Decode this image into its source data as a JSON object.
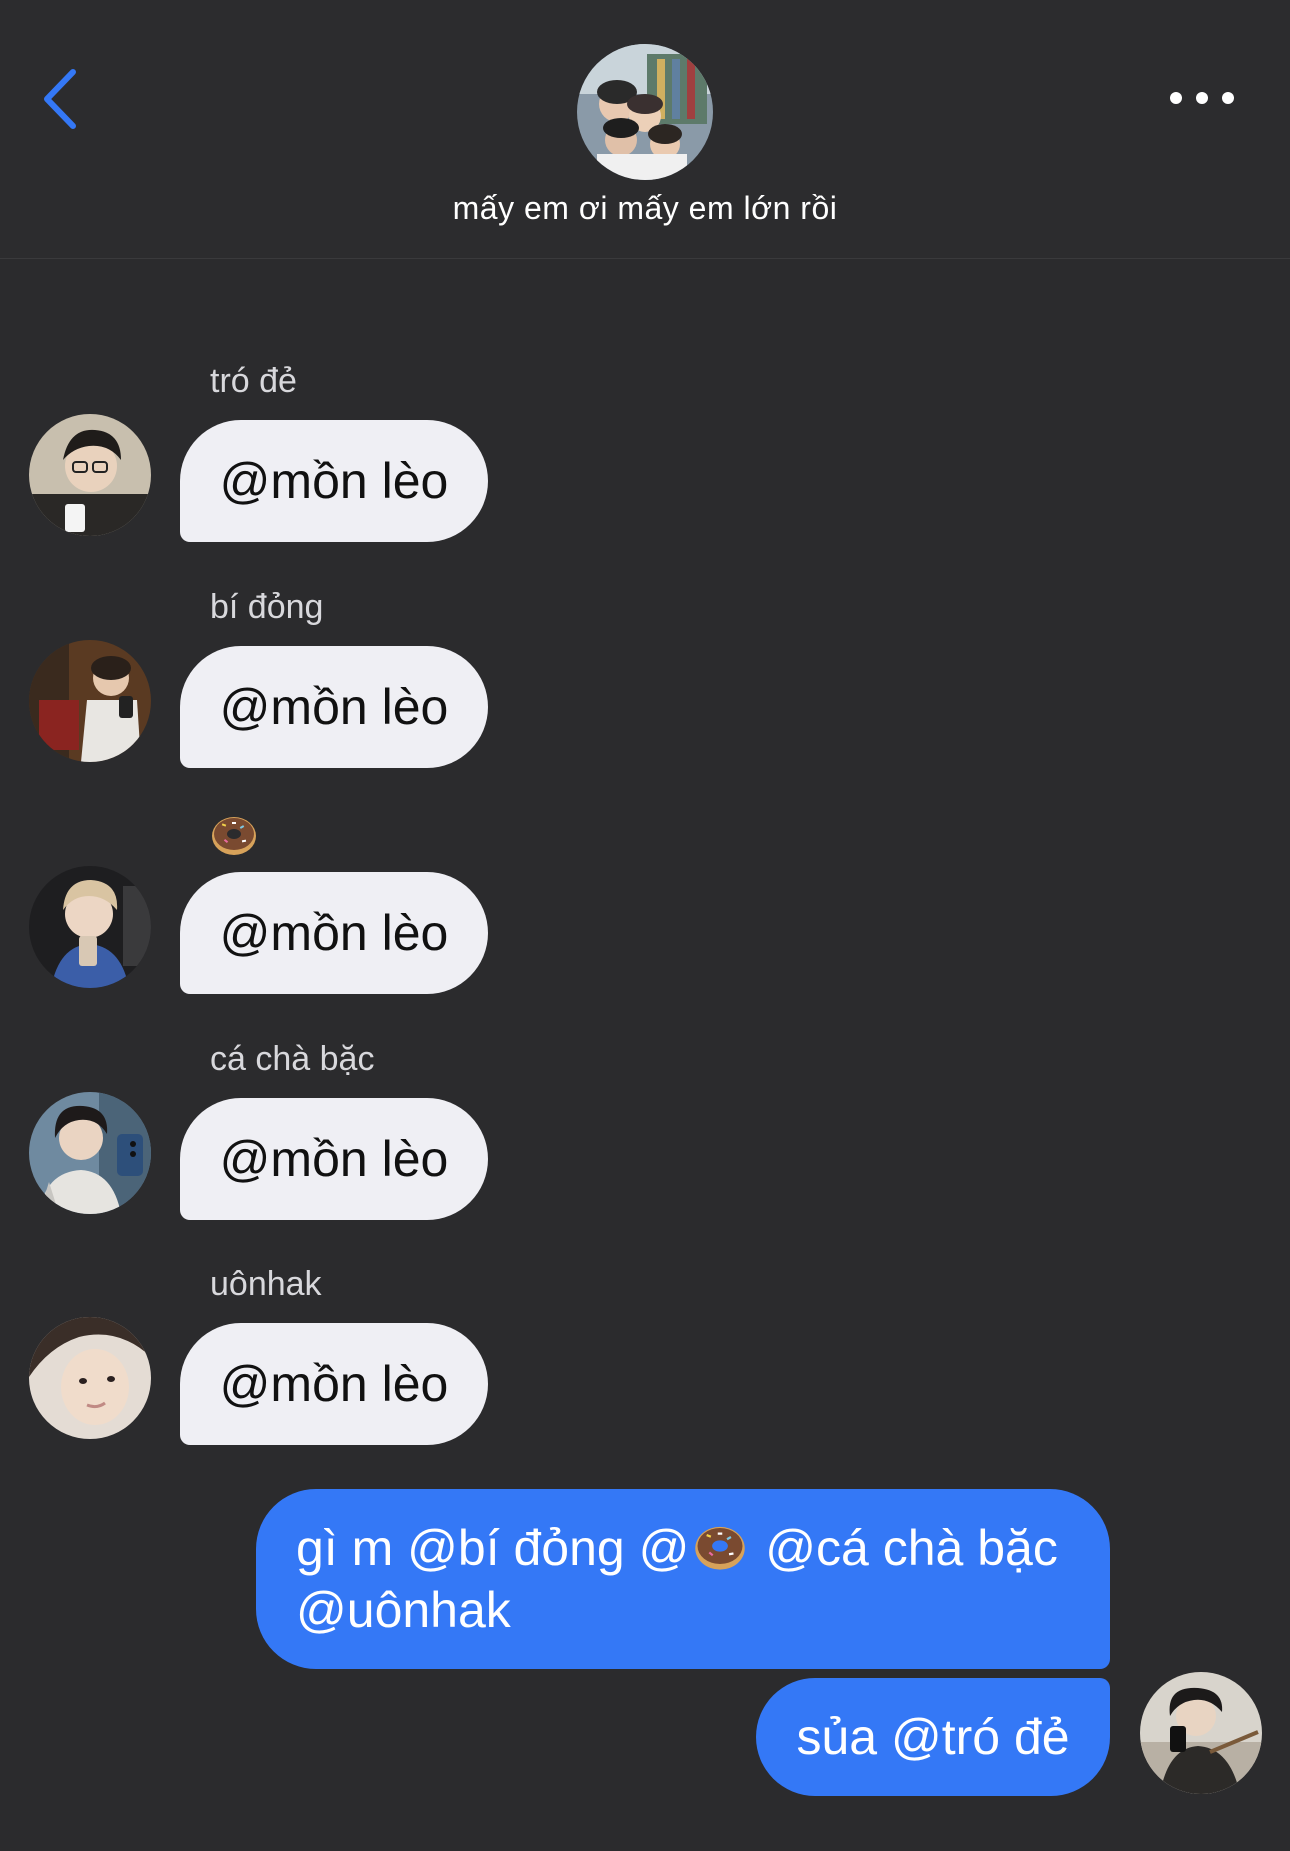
{
  "header": {
    "title": "mấy em ơi mấy em lớn rồi",
    "back_icon": "chevron-left-icon",
    "more_icon": "ellipsis-icon"
  },
  "colors": {
    "background": "#2b2b2d",
    "incoming_bubble": "#efeff4",
    "outgoing_bubble": "#3478f6",
    "accent": "#3478f6"
  },
  "messages": [
    {
      "sender": "tró đẻ",
      "text": "@mồn lèo"
    },
    {
      "sender": "bí đỏng",
      "text": "@mồn lèo"
    },
    {
      "sender": "donut-emoji",
      "text": "@mồn lèo"
    },
    {
      "sender": "cá chà bặc",
      "text": "@mồn lèo"
    },
    {
      "sender": "uônhak",
      "text": "@mồn lèo"
    }
  ],
  "outgoing": [
    {
      "line1_a": "gì m @bí đỏng @",
      "line1_b": " @cá chà bặc",
      "line2": "@uônhak"
    },
    {
      "text": "sủa @tró đẻ"
    }
  ]
}
